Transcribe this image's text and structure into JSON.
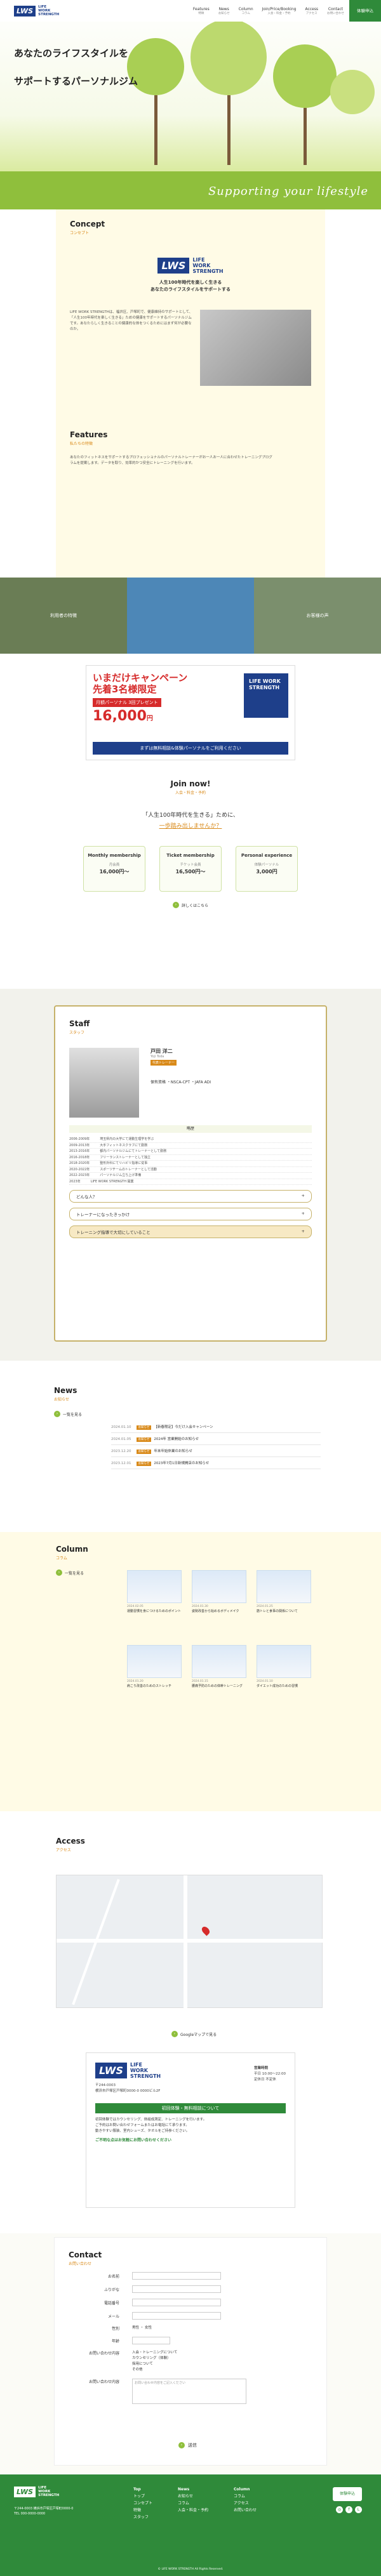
{
  "header": {
    "logo_mark": "LWS",
    "logo_text": [
      "LIFE",
      "WORK",
      "STRENGTH"
    ],
    "nav": [
      {
        "label": "Features",
        "sub": "特徴"
      },
      {
        "label": "News",
        "sub": "お知らせ"
      },
      {
        "label": "Column",
        "sub": "コラム"
      },
      {
        "label": "Join/Price/Booking",
        "sub": "入会・料金・予約"
      },
      {
        "label": "Access",
        "sub": "アクセス"
      },
      {
        "label": "Contact",
        "sub": "お問い合わせ"
      }
    ],
    "trial_label": "体験申込"
  },
  "hero": {
    "copy_line1": "あなたのライフスタイルを",
    "copy_line2": "サポートするパーソナルジム",
    "slogan": "Supporting your lifestyle"
  },
  "concept": {
    "title": "Concept",
    "sub": "コンセプト",
    "tagline_line1": "人生100年時代を楽しく生きる",
    "tagline_line2": "あなたのライフスタイルをサポートする",
    "body": "LIFE WORK STRENGTHは、福井区、戸塚町で、健康維持のサポートとして、「人生100年時代を楽しく生きる」ための健康をサポートするパーソナルジムです。あなたらしく生きることの健康的な体をつくるためにはまず何が必要なのか。"
  },
  "features": {
    "title": "Features",
    "sub": "私たちの特徴",
    "body": "あなたのフィットネスをサポートするプロフェッショナルのパーソナルトレーナーがお一人お一人に合わせたトレーニングプログラムを提案します。データを取り、効率的かつ安全にトレーニングを行います。",
    "tiles": [
      "利用者の特徴",
      "",
      "お客様の声"
    ]
  },
  "campaign": {
    "title_line1": "いまだけキャンペーン",
    "title_line2": "先着3名様限定",
    "banner": "月額パーソナル 3回プレゼント",
    "price": "16,000",
    "price_unit": "円",
    "bottom": "まずは無料相談&体験パーソナルをご利用ください",
    "logo_text": "LIFE WORK STRENGTH"
  },
  "join": {
    "title": "Join now!",
    "sub": "入会・料金・予約",
    "q1": "「人生100年時代を生きる」ために、",
    "q2": "一歩踏み出しませんか？",
    "plans": [
      {
        "name": "Monthly membership",
        "fee": "月会員",
        "price": "16,000円〜"
      },
      {
        "name": "Ticket membership",
        "fee": "チケット会員",
        "price": "16,500円〜"
      },
      {
        "name": "Personal experience",
        "fee": "体験パーソナル",
        "price": "3,000円"
      }
    ],
    "more": "詳しくはこちら"
  },
  "staff": {
    "title": "Staff",
    "sub": "スタッフ",
    "name": "戸田 洋二",
    "romaji": "Yoji Toda",
    "role": "代表トレーナー",
    "qualifications": "保有資格 ・NSCA-CPT ・JAFA ADI",
    "history_label": "略歴",
    "history": [
      {
        "year": "2006-2009年",
        "text": "埼玉県内の大学にて運動生理学を学ぶ"
      },
      {
        "year": "2009-2013年",
        "text": "大手フィットネスクラブにて勤務"
      },
      {
        "year": "2013-2016年",
        "text": "都内パーソナルジムにてトレーナーとして勤務"
      },
      {
        "year": "2016-2018年",
        "text": "フリーランストレーナーとして独立"
      },
      {
        "year": "2018-2020年",
        "text": "整形外科にてリハビリ指導に従事"
      },
      {
        "year": "2020-2022年",
        "text": "スポーツチームのトレーナーとして活動"
      },
      {
        "year": "2022-2023年",
        "text": "パーソナルジム立ち上げ準備"
      },
      {
        "year": "2023年",
        "text": "LIFE WORK STRENGTH 開業"
      }
    ],
    "accordions": [
      "どんな人？",
      "トレーナーになったきっかけ",
      "トレーニング指導で大切にしていること"
    ]
  },
  "news": {
    "title": "News",
    "sub": "お知らせ",
    "more": "一覧を見る",
    "items": [
      {
        "date": "2024.01.10",
        "tag": "お知らせ",
        "title": "【新春限定】今だけ入会キャンペーン"
      },
      {
        "date": "2024.01.05",
        "tag": "お知らせ",
        "title": "2024年 営業開始のお知らせ"
      },
      {
        "date": "2023.12.20",
        "tag": "お知らせ",
        "title": "年末年始休業のお知らせ"
      },
      {
        "date": "2023.12.01",
        "tag": "お知らせ",
        "title": "2023年7月1日新規開店のお知らせ"
      }
    ]
  },
  "column": {
    "title": "Column",
    "sub": "コラム",
    "more": "一覧を見る",
    "items": [
      {
        "date": "2024.02.05",
        "title": "運動習慣を身につけるためのポイント"
      },
      {
        "date": "2024.01.30",
        "title": "姿勢改善から始めるボディメイク"
      },
      {
        "date": "2024.01.25",
        "title": "筋トレと食事の関係について"
      },
      {
        "date": "2024.01.20",
        "title": "肩こり改善のためのストレッチ"
      },
      {
        "date": "2024.01.15",
        "title": "腰痛予防のための体幹トレーニング"
      },
      {
        "date": "2024.01.10",
        "title": "ダイエット成功のための習慣"
      }
    ]
  },
  "access": {
    "title": "Access",
    "sub": "アクセス",
    "more": "Googleマップで見る",
    "postal": "〒244-0003",
    "address": "横浜市戸塚区戸塚町0000-0 0000ビル2F",
    "hours_title": "営業時間",
    "hours": "平日 10:00〜22:00",
    "holidays": "定休日 不定休",
    "bar": "初回体験・無料相談について",
    "notes": [
      "初回体験ではカウンセリング、体組成測定、トレーニングを行います。",
      "ご予約はお問い合わせフォームまたはお電話にて承ります。",
      "動きやすい服装、室内シューズ、タオルをご持参ください。"
    ],
    "green_note": "ご不明な点はお気軽にお問い合わせください"
  },
  "contact": {
    "title": "Contact",
    "sub": "お問い合わせ",
    "fields": [
      "お名前",
      "ふりがな",
      "電話番号",
      "メール",
      "性別",
      "年齢"
    ],
    "gender_options": "男性 ・ 女性",
    "interest_label": "お問い合わせ内容",
    "interest_options": [
      "入会・トレーニングについて",
      "カウンセリング（体験）",
      "採用について",
      "その他"
    ],
    "message_label": "お問い合わせ内容",
    "message_placeholder": "お問い合わせ内容をご記入ください",
    "send": "送信"
  },
  "footer": {
    "address": "〒244-0003 横浜市戸塚区戸塚町0000-0",
    "tel": "TEL 000-0000-0000",
    "cols": [
      {
        "head": "Top",
        "items": [
          "トップ",
          "コンセプト",
          "特徴",
          "スタッフ"
        ]
      },
      {
        "head": "News",
        "items": [
          "お知らせ",
          "コラム",
          "入会・料金・予約"
        ]
      },
      {
        "head": "Column",
        "items": [
          "コラム",
          "アクセス",
          "お問い合わせ"
        ]
      }
    ],
    "trial": "体験申込",
    "copyright": "© LIFE WORK STRENGTH All Rights Reserved."
  }
}
